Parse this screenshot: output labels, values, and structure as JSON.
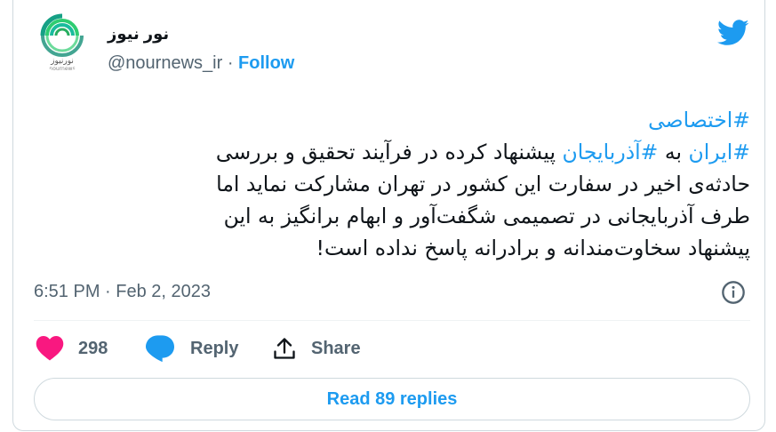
{
  "account": {
    "display_name": "نور نیوز",
    "handle": "@nournews_ir",
    "separator": "·",
    "follow_label": "Follow",
    "avatar_text": "نورنیوز",
    "avatar_subtext": "nournews"
  },
  "tweet": {
    "hashtag1": "#اختصاصی",
    "line2_tag1": "#ایران",
    "line2_word": " به ",
    "line2_tag2": "#آذربایجان",
    "line2_rest": " پیشنهاد کرده در فرآیند تحقیق و بررسی",
    "line3": "حادثه‌ی اخیر در سفارت این کشور در تهران مشارکت نماید اما",
    "line4": "طرف آذربایجانی در تصمیمی شگفت‌آور و ابهام برانگیز به این",
    "line5": "پیشنهاد سخاوت‌مندانه و برادرانه پاسخ نداده است!",
    "timestamp": "6:51 PM · Feb 2, 2023"
  },
  "actions": {
    "like_count": "298",
    "reply_label": "Reply",
    "share_label": "Share"
  },
  "read_replies_label": "Read 89 replies",
  "colors": {
    "accent": "#1d9bf0",
    "like": "#f91880",
    "text": "#0f1419",
    "muted": "#536471",
    "border": "#cfd9de"
  },
  "icons": [
    "twitter-bird-icon",
    "info-icon",
    "heart-icon",
    "reply-bubble-icon",
    "share-upload-icon"
  ]
}
